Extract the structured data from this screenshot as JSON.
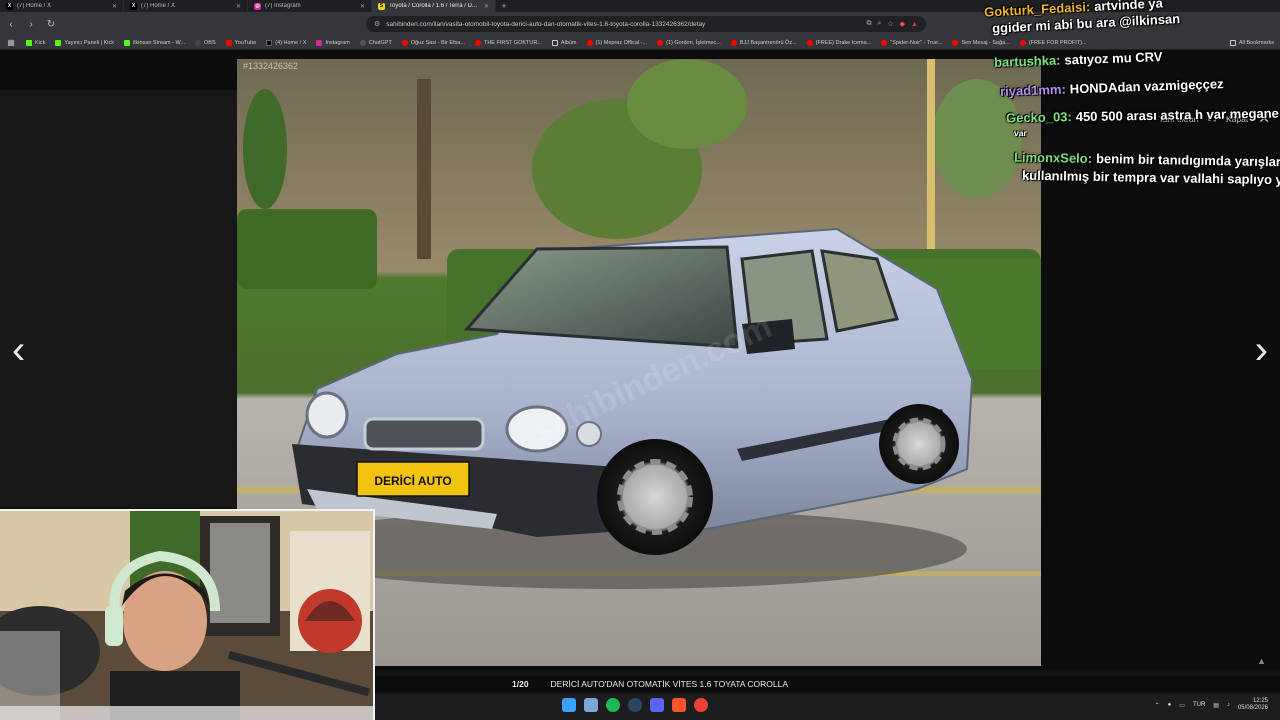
{
  "tabs": [
    {
      "title": "(7) Home / X",
      "icon": "x-icon",
      "color": "#000000",
      "glyph": "X"
    },
    {
      "title": "(7) Home / X",
      "icon": "x-icon",
      "color": "#000000",
      "glyph": "X"
    },
    {
      "title": "(7) Instagram",
      "icon": "instagram-icon",
      "color": "#d6249f",
      "glyph": "◎"
    },
    {
      "title": "Toyota / Corolla / 1.6 / Terra / D...",
      "icon": "sahibinden-icon",
      "color": "#f6d600",
      "glyph": "S",
      "active": true
    }
  ],
  "address": {
    "url": "sahibinden.com/ilan/vasita-otomobil-toyota-derici-auto-dan-otomatik-vites-1.6-toyota-corolla-1332426362/detay"
  },
  "bookmarks": [
    {
      "label": "Kick",
      "color": "#53fc18"
    },
    {
      "label": "Yayıncı Paneli | Kick",
      "color": "#53fc18"
    },
    {
      "label": "ilkinsan Stream - W...",
      "color": "#53fc18"
    },
    {
      "label": "OBS",
      "color": "#444444"
    },
    {
      "label": "YouTube",
      "color": "#ff0000"
    },
    {
      "label": "(4) Home / X",
      "color": "#000000"
    },
    {
      "label": "Instagram",
      "color": "#d6249f"
    },
    {
      "label": "ChatGPT",
      "color": "#555555"
    },
    {
      "label": "Oğuz Sasi - Bir Efsa...",
      "color": "#ff0000"
    },
    {
      "label": "THE FIRST GOKTUR...",
      "color": "#ff0000"
    },
    {
      "label": "Albüm",
      "color": "#888888"
    },
    {
      "label": "(1) Mepraz Offical -...",
      "color": "#ff0000"
    },
    {
      "label": "(1) Gordon, İşletmec...",
      "color": "#ff0000"
    },
    {
      "label": "BJJ Başantrenörü Öz...",
      "color": "#ff0000"
    },
    {
      "label": "(FREE) Drake Icema...",
      "color": "#ff0000"
    },
    {
      "label": "\"Spider-Noir\" - True...",
      "color": "#ff0000"
    },
    {
      "label": "Sen Mesaj - Sağa...",
      "color": "#ff0000"
    },
    {
      "label": "(FREE FOR PROFIT)...",
      "color": "#ff0000"
    }
  ],
  "bookmarks_all": "All Bookmarks",
  "viewer": {
    "listing_id": "#1332426362",
    "fullscreen_label": "Tam ekran",
    "close_label": "Kapat",
    "photo_counter": "1/20",
    "photo_caption": "DERİCİ AUTO'DAN OTOMATİK VİTES 1.6 TOYATA COROLLA",
    "plate_text": "DERİCİ AUTO",
    "photo_watermark": "sahibinden.com"
  },
  "chat": [
    {
      "user": "Gokturk_Fedaisi:",
      "user_color": "#f0b429",
      "text": "artvinde ya"
    },
    {
      "user": "",
      "user_color": "#ffffff",
      "text": "ggider mi abi bu ara @ilkinsan"
    },
    {
      "user": "bartushka:",
      "user_color": "#7ee07e",
      "text": "satıyoz mu CRV"
    },
    {
      "user": "riyad1mm:",
      "user_color": "#b48cf0",
      "text": "HONDAdan vazmigeççez"
    },
    {
      "user": "Gecko_03:",
      "user_color": "#7ee07e",
      "text": "450 500 arası astra h var megane"
    },
    {
      "user": "",
      "user_color": "#ffffff",
      "text": "var"
    },
    {
      "user": "LimonxSelo:",
      "user_color": "#7ee07e",
      "text": "benim bir tanıdıgımda yarışlard"
    },
    {
      "user": "",
      "user_color": "#ffffff",
      "text": "kullanılmış bir tempra var vallahi saplıyo ya"
    }
  ],
  "taskbar": {
    "lang": "TUR",
    "time": "12:25",
    "date": "05/08/2026",
    "apps": [
      {
        "name": "windows-start-icon",
        "color": "#3aa0ff"
      },
      {
        "name": "file-explorer-icon",
        "color": "#7aa7d6"
      },
      {
        "name": "spotify-icon",
        "color": "#1db954"
      },
      {
        "name": "steam-icon",
        "color": "#2a475e"
      },
      {
        "name": "discord-icon",
        "color": "#5865f2"
      },
      {
        "name": "brave-icon",
        "color": "#fb542b"
      },
      {
        "name": "chrome-icon",
        "color": "#e94235"
      }
    ]
  }
}
